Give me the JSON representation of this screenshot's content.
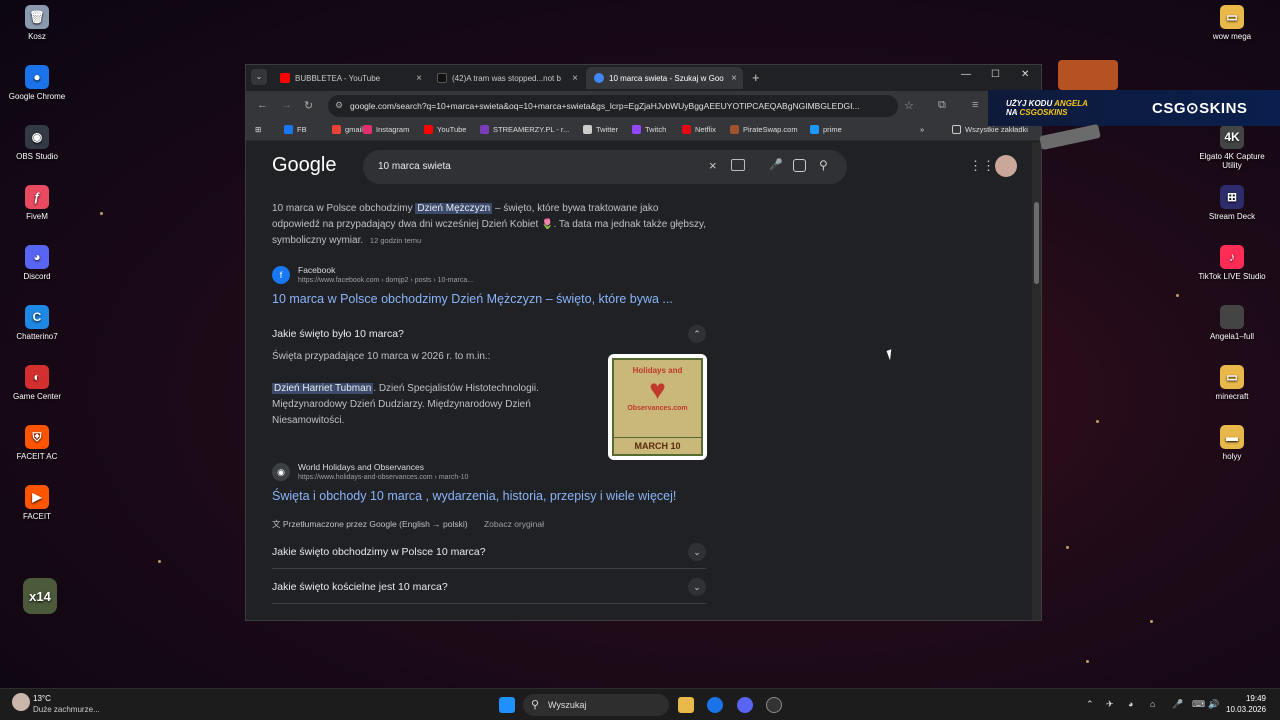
{
  "desktop": {
    "left_icons": [
      {
        "label": "Kosz",
        "color": "#8a9bb0",
        "glyph": "🗑"
      },
      {
        "label": "Google Chrome",
        "color": "#1a73e8",
        "glyph": "●"
      },
      {
        "label": "OBS Studio",
        "color": "#333a44",
        "glyph": "◉"
      },
      {
        "label": "FiveM",
        "color": "#e84a5f",
        "glyph": "ƒ"
      },
      {
        "label": "Discord",
        "color": "#5865f2",
        "glyph": "◕"
      },
      {
        "label": "Chatterino7",
        "color": "#1e88e5",
        "glyph": "C"
      },
      {
        "label": "Game Center",
        "color": "#d32f2f",
        "glyph": "◐"
      },
      {
        "label": "FACEIT AC",
        "color": "#ff5500",
        "glyph": "⛨"
      },
      {
        "label": "FACEIT",
        "color": "#ff5500",
        "glyph": "▶"
      }
    ],
    "right_icons": [
      {
        "label": "wow mega",
        "color": "#e8b84a",
        "glyph": "▭"
      },
      {
        "label": "Elgato 4K Capture Utility",
        "color": "#444",
        "glyph": "4K"
      },
      {
        "label": "Stream Deck",
        "color": "#2d2d6e",
        "glyph": "⊞"
      },
      {
        "label": "TikTok LIVE Studio",
        "color": "#ff2d55",
        "glyph": "♪"
      },
      {
        "label": "Angela1–full",
        "color": "#444",
        "glyph": ""
      },
      {
        "label": "minecraft",
        "color": "#e8b84a",
        "glyph": "▭"
      },
      {
        "label": "holyy",
        "color": "#e8b84a",
        "glyph": "▬"
      }
    ],
    "x14_label": "x14"
  },
  "browser": {
    "tabs": [
      {
        "title": "BUBBLETEA - YouTube",
        "icon": "youtube-icon",
        "color": "#ff0000"
      },
      {
        "title": "(42)A tram was stopped...not b",
        "icon": "tiktok-icon",
        "color": "#111"
      },
      {
        "title": "10 marca swieta - Szukaj w Goo",
        "icon": "google-icon",
        "color": "#4285f4"
      }
    ],
    "new_tab": "+",
    "url": "google.com/search?q=10+marca+swieta&oq=10+marca+swieta&gs_lcrp=EgZjaHJvbWUyBggAEEUYOTIPCAEQABgNGIMBGLEDGI...",
    "bookmarks": [
      {
        "label": "FB",
        "color": "#1877f2"
      },
      {
        "label": "gmail",
        "color": "#ea4335"
      },
      {
        "label": "Instagram",
        "color": "#e1306c"
      },
      {
        "label": "YouTube",
        "color": "#ff0000"
      },
      {
        "label": "STREAMERZY.PL - r...",
        "color": "#7a3db8"
      },
      {
        "label": "Twitter",
        "color": "#cccccc"
      },
      {
        "label": "Twitch",
        "color": "#9146ff"
      },
      {
        "label": "Netflix",
        "color": "#e50914"
      },
      {
        "label": "PirateSwap.com",
        "color": "#a0522d"
      },
      {
        "label": "prime",
        "color": "#1a98ff"
      }
    ],
    "all_bookmarks": "Wszystkie zakładki",
    "more": "»"
  },
  "search": {
    "logo": "Google",
    "query": "10 marca swieta"
  },
  "results": {
    "snippet1": {
      "pre": "10 marca w Polsce obchodzimy ",
      "highlight": "Dzień Mężczyzn",
      "post": " – święto, które bywa traktowane jako odpowiedź na przypadający dwa dni wcześniej Dzień Kobiet 🌷. Ta data ma jednak także głębszy, symboliczny wymiar.",
      "time": "12 godzin temu"
    },
    "fb": {
      "site": "Facebook",
      "url": "https://www.facebook.com › domjp2 › posts › 10-marca...",
      "title": "10 marca w Polsce obchodzimy Dzień Mężczyzn – święto, które bywa ..."
    },
    "paa_open": {
      "question": "Jakie święto było 10 marca?",
      "lead": "Święta przypadające 10 marca w 2026 r. to m.in.:",
      "highlight": "Dzień Harriet Tubman",
      "rest": ". Dzień Specjalistów Histotechnologii. Międzynarodowy Dzień Dudziarzy. Międzynarodowy Dzień Niesamowitości.",
      "image_top": "Holidays and",
      "image_bottom": "Observances.com",
      "image_date": "MARCH 10"
    },
    "world": {
      "site": "World Holidays and Observances",
      "url": "https://www.holidays-and-observances.com › march-10",
      "title": "Święta i obchody 10 marca , wydarzenia, historia, przepisy i wiele więcej!",
      "translated": "Przetłumaczone przez Google (English → polski)",
      "see_original": "Zobacz oryginał"
    },
    "more_questions": [
      "Jakie święto obchodzimy w Polsce 10 marca?",
      "Jakie święto kościelne jest 10 marca?"
    ]
  },
  "banner": {
    "line1_pre": "UŻYJ KODU ",
    "line1_code": "ANGELA",
    "line2_pre": "NA ",
    "line2_site": "CSGOSKINS",
    "brand": "CSG⊙SKINS"
  },
  "taskbar": {
    "temp": "13°C",
    "weather": "Duże zachmurze...",
    "search_placeholder": "Wyszukaj",
    "time": "19:49",
    "date": "10.03.2026"
  }
}
